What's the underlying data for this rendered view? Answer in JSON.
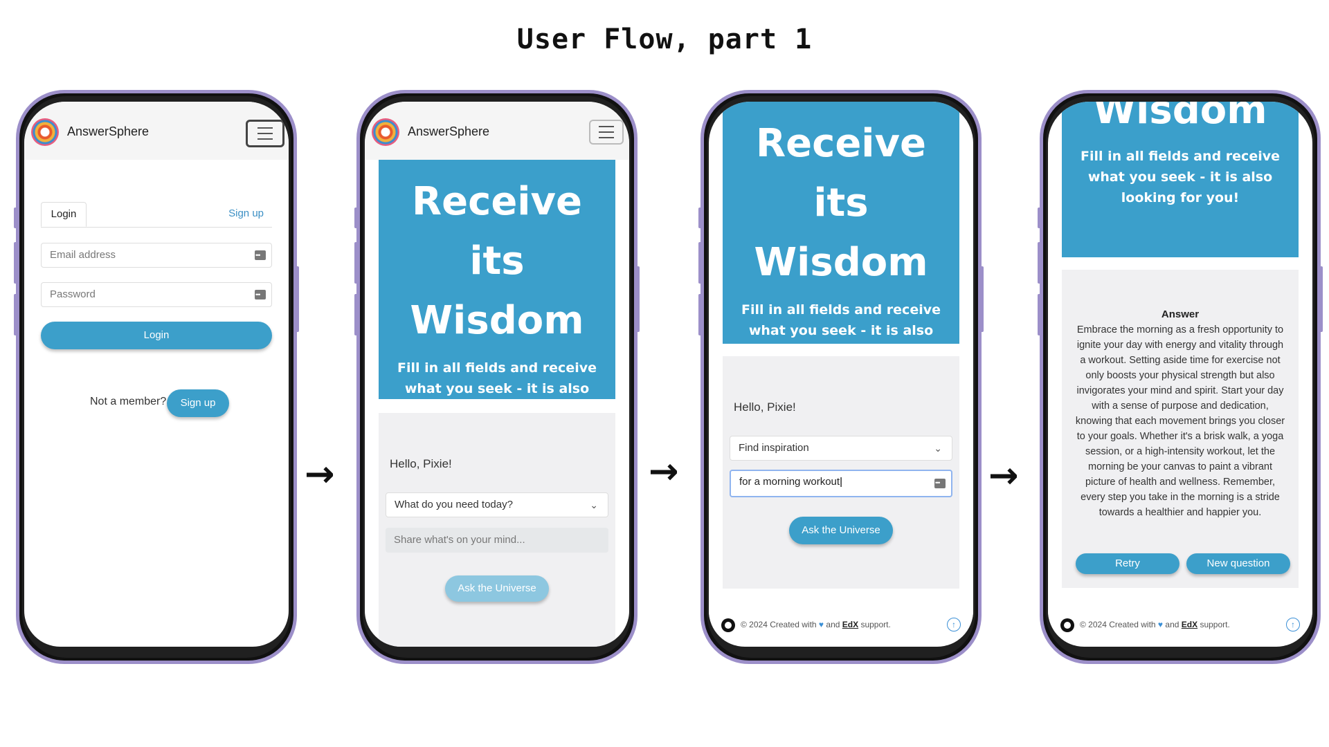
{
  "title": "User Flow, part 1",
  "brand": "AnswerSphere",
  "login": {
    "tab_login": "Login",
    "tab_signup": "Sign up",
    "email_placeholder": "Email address",
    "password_placeholder": "Password",
    "login_button": "Login",
    "not_member": "Not a member?",
    "signup_button": "Sign up"
  },
  "hero": {
    "line1": "Receive its",
    "line2": "Wisdom",
    "subtitle": "Fill in all fields and receive what you seek - it is also looking for you!"
  },
  "form": {
    "greeting": "Hello, Pixie!",
    "select_placeholder": "What do you need today?",
    "text_placeholder": "Share what's on your mind...",
    "ask_button": "Ask the Universe",
    "selected_option": "Find inspiration",
    "typed_text": "for a morning workout"
  },
  "answer": {
    "title": "Answer",
    "text": "Embrace the morning as a fresh opportunity to ignite your day with energy and vitality through a workout. Setting aside time for exercise not only boosts your physical strength but also invigorates your mind and spirit. Start your day with a sense of purpose and dedication, knowing that each movement brings you closer to your goals. Whether it's a brisk walk, a yoga session, or a high-intensity workout, let the morning be your canvas to paint a vibrant picture of health and wellness. Remember, every step you take in the morning is a stride towards a healthier and happier you.",
    "retry_button": "Retry",
    "new_question_button": "New question"
  },
  "footer": {
    "prefix": "© 2024 Created with",
    "middle": "and",
    "edx": "EdX",
    "suffix": "support."
  },
  "arrow": "→",
  "colors": {
    "accent": "#3b9fcb",
    "frame": "#9c8fc9"
  }
}
